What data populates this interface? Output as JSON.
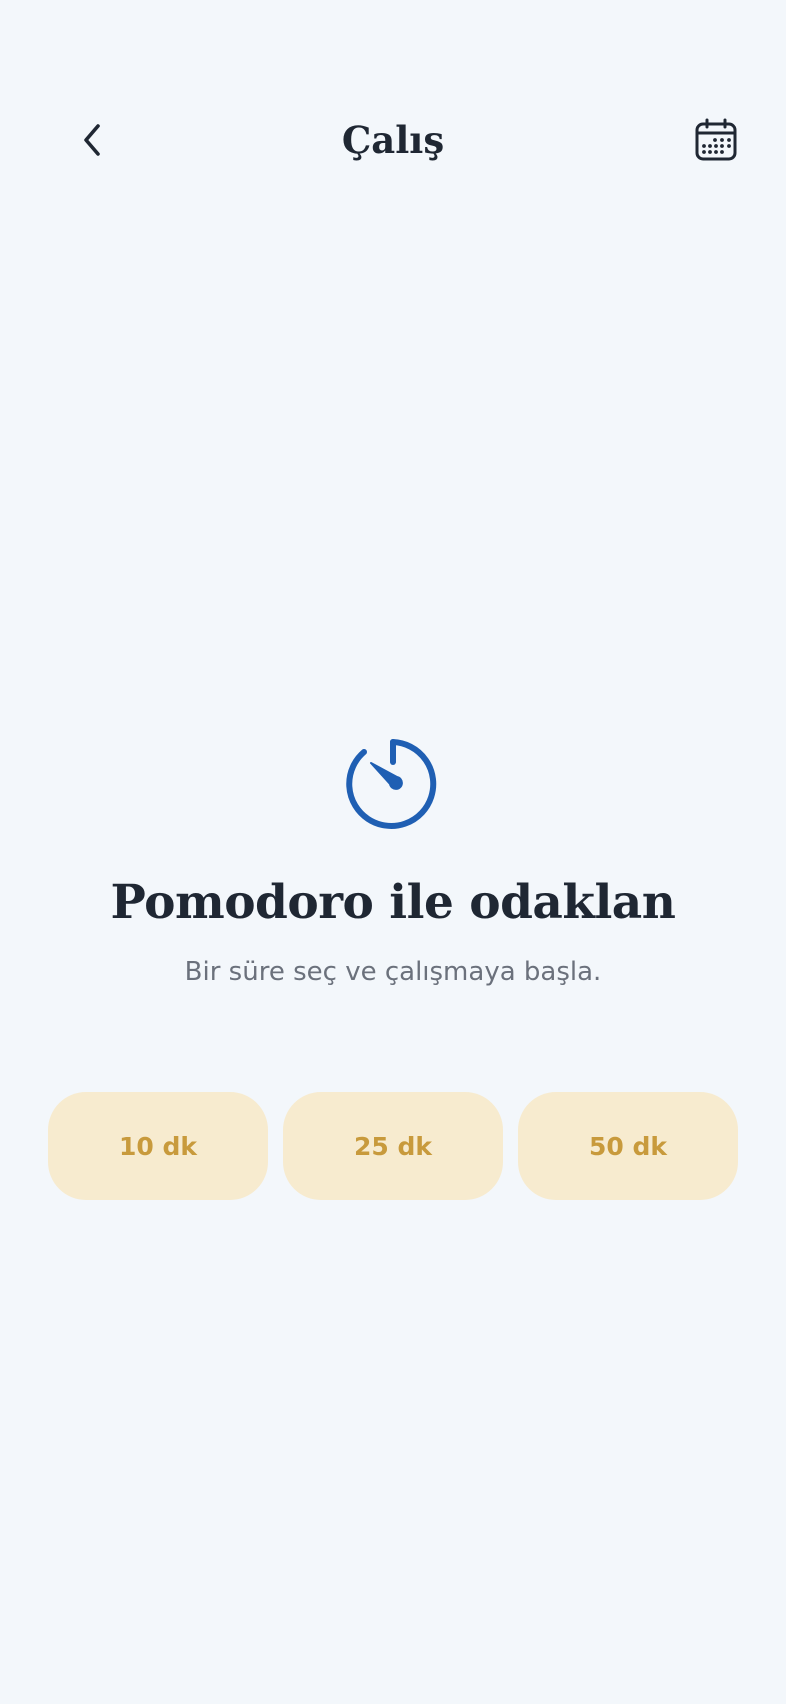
{
  "header": {
    "title": "Çalış",
    "back_icon": "chevron-left-icon",
    "calendar_icon": "calendar-icon"
  },
  "hero": {
    "icon": "timer-icon",
    "title": "Pomodoro ile odaklan",
    "subtitle": "Bir süre seç ve çalışmaya başla."
  },
  "durations": [
    {
      "label": "10 dk"
    },
    {
      "label": "25 dk"
    },
    {
      "label": "50 dk"
    }
  ],
  "colors": {
    "background": "#f3f7fb",
    "text_primary": "#1f2733",
    "text_secondary": "#6b717c",
    "accent_blue": "#1f5fb3",
    "duration_bg": "#f7ebcf",
    "duration_text": "#c89a3c"
  }
}
